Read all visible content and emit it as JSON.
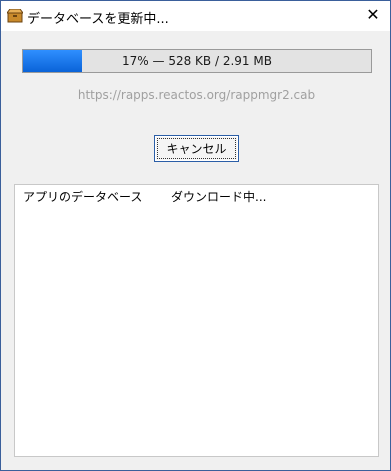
{
  "window": {
    "title": "データベースを更新中...",
    "close_glyph": "✕",
    "icon": "package-icon"
  },
  "progress": {
    "percent": 17,
    "text": "17% — 528 KB / 2.91 MB",
    "fill_color": "#0a63d8"
  },
  "url": "https://rapps.reactos.org/rappmgr2.cab",
  "cancel_label": "キャンセル",
  "list": {
    "items": [
      {
        "name": "アプリのデータベース",
        "status": "ダウンロード中..."
      }
    ]
  }
}
